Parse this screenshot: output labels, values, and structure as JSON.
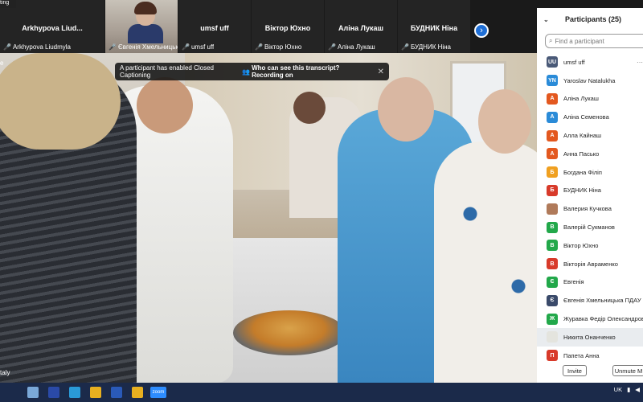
{
  "window": {
    "title_fragment": "ting"
  },
  "gallery": {
    "tiles": [
      {
        "big": "Arkhypova  Liud...",
        "small": "Arkhypova Liudmyla"
      },
      {
        "big": "",
        "small": "Євгенія  Хмельницьк..."
      },
      {
        "big": "umsf uff",
        "small": "umsf uff"
      },
      {
        "big": "Віктор Юхно",
        "small": "Віктор Юхно"
      },
      {
        "big": "Аліна Лукаш",
        "small": "Аліна Лукаш"
      },
      {
        "big": "БУДНИК Ніна",
        "small": "БУДНИК Ніна"
      }
    ],
    "next_icon": "chevron-right-icon"
  },
  "video": {
    "left_edge_text": "e",
    "speaker_name_fragment": "taly",
    "cc_banner": {
      "message": "A participant has enabled Closed Captioning",
      "question": "Who can see this transcript? Recording on",
      "close": "✕"
    }
  },
  "participants_panel": {
    "title": "Participants (25)",
    "search_placeholder": "Find a participant",
    "participants": [
      {
        "initials": "UU",
        "name": "umsf uff",
        "color": "#4a5a78"
      },
      {
        "initials": "YN",
        "name": "Yaroslav Natalukha",
        "color": "#2a8bd8"
      },
      {
        "initials": "А",
        "name": "Аліна Лукаш",
        "color": "#e3581f"
      },
      {
        "initials": "А",
        "name": "Аліна Семенова",
        "color": "#2a8bd8"
      },
      {
        "initials": "А",
        "name": "Алла Кайнаш",
        "color": "#e3581f"
      },
      {
        "initials": "А",
        "name": "Анна Пасько",
        "color": "#e3581f"
      },
      {
        "initials": "Б",
        "name": "Богдана Філіп",
        "color": "#f0a020"
      },
      {
        "initials": "Б",
        "name": "БУДНИК Ніна",
        "color": "#d83a2a"
      },
      {
        "initials": "",
        "name": "Валерия Кучкова",
        "color": "#b07a5a"
      },
      {
        "initials": "В",
        "name": "Валерій Сукманов",
        "color": "#22a84a"
      },
      {
        "initials": "В",
        "name": "Віктор Юхно",
        "color": "#22a84a"
      },
      {
        "initials": "В",
        "name": "Вікторія Авраменко",
        "color": "#d83a2a"
      },
      {
        "initials": "Є",
        "name": "Евгенія",
        "color": "#22a84a"
      },
      {
        "initials": "Є",
        "name": "Євгенія  Хмельницька ПДАУ",
        "color": "#3a4a6a"
      },
      {
        "initials": "Ж",
        "name": "Журавка Федір Олександрови",
        "color": "#22a84a"
      },
      {
        "initials": "",
        "name": "Никита Онанченко",
        "color": "#e4e4de"
      },
      {
        "initials": "П",
        "name": "Папета Анна",
        "color": "#d83a2a"
      }
    ],
    "invite_label": "Invite",
    "mute_label": "Unmute M"
  },
  "taskbar": {
    "apps": [
      {
        "icon": "start-icon",
        "color": "#1b2a4a"
      },
      {
        "icon": "file-icon",
        "color": "#7aa8d8"
      },
      {
        "icon": "save-icon",
        "color": "#2a4aa8"
      },
      {
        "icon": "edge-icon",
        "color": "#2a9ad8"
      },
      {
        "icon": "chrome-icon",
        "color": "#e8b020"
      },
      {
        "icon": "word-icon",
        "color": "#2a5ab8"
      },
      {
        "icon": "chrome-icon",
        "color": "#e8b020"
      },
      {
        "icon": "zoom-icon",
        "color": "#2d8cff"
      }
    ],
    "zoom_label": "zoom",
    "tray_lang": "UK"
  }
}
